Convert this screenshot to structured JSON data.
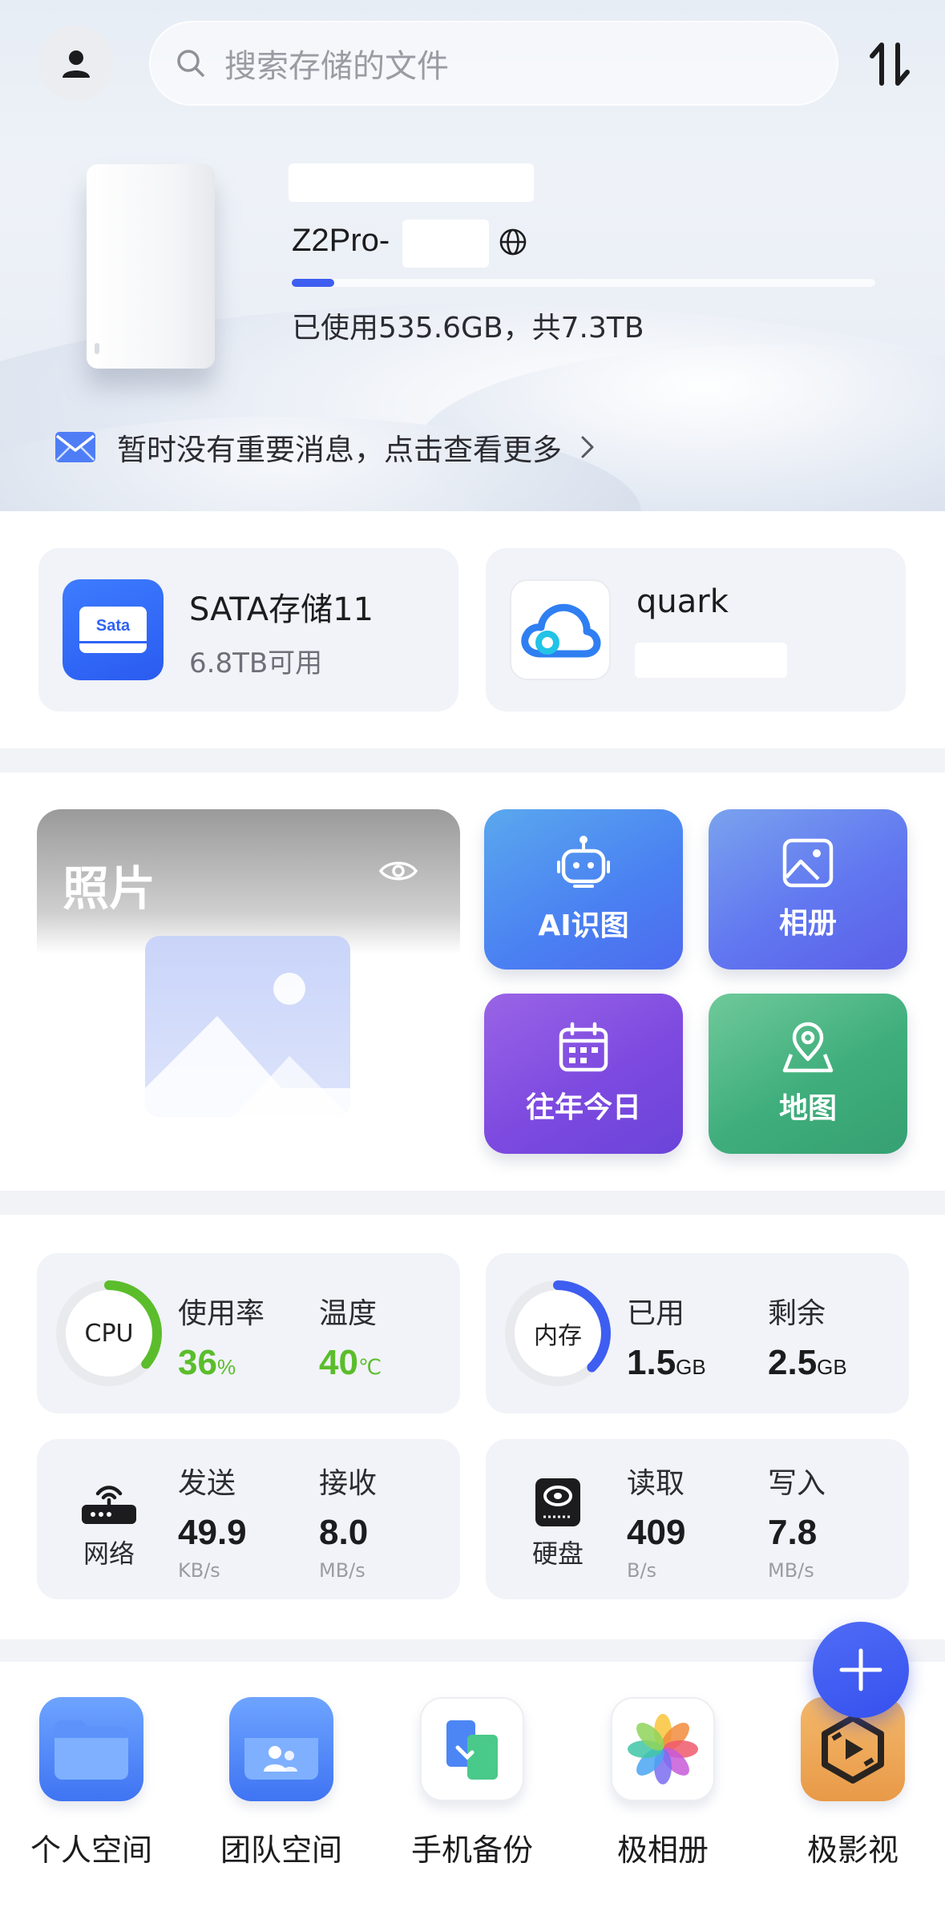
{
  "header": {
    "search_placeholder": "搜索存储的文件"
  },
  "device": {
    "name": "Z2Pro-",
    "usage_text": "已使用535.6GB，共7.3TB",
    "used_fraction": 0.073
  },
  "notice": {
    "text": "暂时没有重要消息，点击查看更多"
  },
  "storage": [
    {
      "title": "SATA存储11",
      "subtitle": "6.8TB可用",
      "icon": "sata-disk-icon",
      "icon_text": "Sata"
    },
    {
      "title": "quark",
      "icon": "quark-cloud-icon"
    }
  ],
  "photos": {
    "title": "照片",
    "tiles": [
      {
        "label": "AI识图",
        "icon": "robot-icon"
      },
      {
        "label": "相册",
        "icon": "image-icon"
      },
      {
        "label": "往年今日",
        "icon": "calendar-icon"
      },
      {
        "label": "地图",
        "icon": "map-pin-icon"
      }
    ]
  },
  "stats": {
    "cpu": {
      "label": "CPU",
      "usage_label": "使用率",
      "usage_value": "36",
      "usage_unit": "%",
      "temp_label": "温度",
      "temp_value": "40",
      "temp_unit": "℃",
      "ring_fraction": 0.36,
      "ring_color": "#5bbd2b"
    },
    "memory": {
      "label": "内存",
      "used_label": "已用",
      "used_value": "1.5",
      "used_unit": "GB",
      "free_label": "剩余",
      "free_value": "2.5",
      "free_unit": "GB",
      "ring_fraction": 0.375,
      "ring_color": "#3d5ef0"
    },
    "network": {
      "label": "网络",
      "send_label": "发送",
      "send_value": "49.9",
      "send_unit": "KB/s",
      "recv_label": "接收",
      "recv_value": "8.0",
      "recv_unit": "MB/s"
    },
    "disk": {
      "label": "硬盘",
      "read_label": "读取",
      "read_value": "409",
      "read_unit": "B/s",
      "write_label": "写入",
      "write_value": "7.8",
      "write_unit": "MB/s"
    }
  },
  "apps": [
    {
      "label": "个人空间",
      "icon": "folder-icon"
    },
    {
      "label": "团队空间",
      "icon": "team-folder-icon"
    },
    {
      "label": "手机备份",
      "icon": "phone-backup-icon"
    },
    {
      "label": "极相册",
      "icon": "flower-photos-icon"
    },
    {
      "label": "极影视",
      "icon": "film-icon"
    }
  ],
  "colors": {
    "accent": "#3d5ef0",
    "green": "#5bbd2b"
  }
}
